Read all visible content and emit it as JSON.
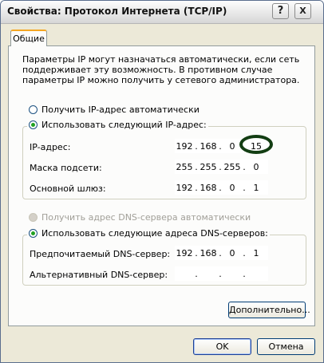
{
  "window": {
    "title": "Свойства: Протокол Интернета (TCP/IP)",
    "help_label": "?",
    "close_label": "X"
  },
  "tabs": [
    {
      "label": "Общие"
    }
  ],
  "description": "Параметры IP могут назначаться автоматически, если сеть поддерживает эту возможность. В противном случае параметры IP можно получить у сетевого администратора.",
  "ip_options": {
    "auto_label": "Получить IP-адрес автоматически",
    "manual_label": "Использовать следующий IP-адрес:",
    "selected": "manual"
  },
  "ip_fields": [
    {
      "label": "IP-адрес:",
      "octets": [
        "192",
        "168",
        "0",
        "15"
      ]
    },
    {
      "label": "Маска подсети:",
      "octets": [
        "255",
        "255",
        "255",
        "0"
      ]
    },
    {
      "label": "Основной шлюз:",
      "octets": [
        "192",
        "168",
        "0",
        "1"
      ]
    }
  ],
  "dns_options": {
    "auto_label": "Получить адрес DNS-сервера автоматически",
    "manual_label": "Использовать следующие адреса DNS-серверов:",
    "selected": "manual"
  },
  "dns_fields": [
    {
      "label": "Предпочитаемый DNS-сервер:",
      "octets": [
        "192",
        "168",
        "0",
        "1"
      ]
    },
    {
      "label": "Альтернативный DNS-сервер:",
      "octets": [
        "",
        "",
        "",
        ""
      ]
    }
  ],
  "buttons": {
    "advanced": "Дополнительно...",
    "ok": "OK",
    "cancel": "Отмена"
  },
  "highlight_color": "#123d12"
}
